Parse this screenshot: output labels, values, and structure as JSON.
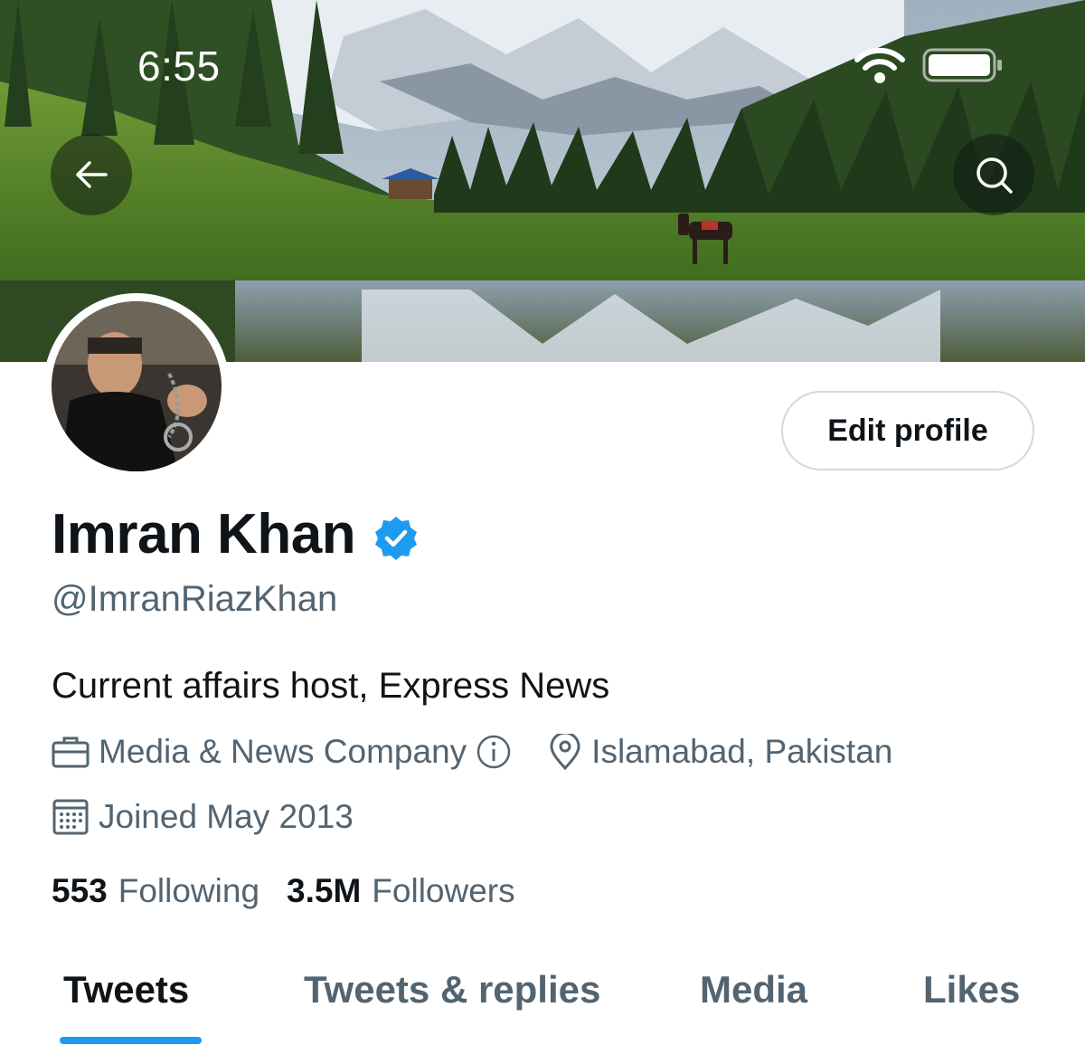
{
  "status_bar": {
    "time": "6:55"
  },
  "header": {
    "back_icon": "arrow-left-icon",
    "search_icon": "search-icon"
  },
  "profile": {
    "name": "Imran Khan",
    "verified": true,
    "handle": "@ImranRiazKhan",
    "bio": "Current affairs host, Express News",
    "category": "Media & News Company",
    "location": "Islamabad, Pakistan",
    "joined": "Joined May 2013",
    "edit_label": "Edit profile"
  },
  "stats": {
    "following_count": "553",
    "following_label": "Following",
    "followers_count": "3.5M",
    "followers_label": "Followers"
  },
  "tabs": [
    {
      "label": "Tweets",
      "active": true
    },
    {
      "label": "Tweets & replies",
      "active": false
    },
    {
      "label": "Media",
      "active": false
    },
    {
      "label": "Likes",
      "active": false
    }
  ],
  "colors": {
    "accent": "#1d9bf0",
    "text_primary": "#0f1419",
    "text_secondary": "#536471",
    "verified": "#1d9bf0"
  }
}
